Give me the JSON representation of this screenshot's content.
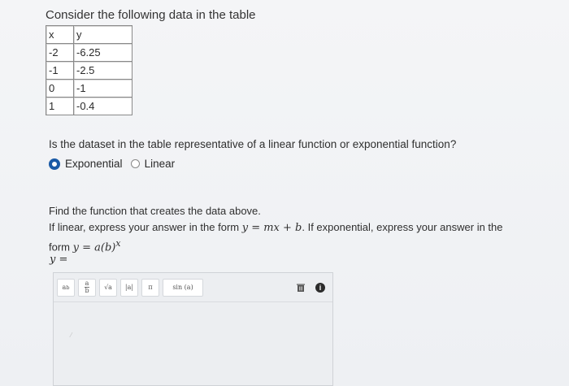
{
  "heading": "Consider the following data in the table",
  "table": {
    "headers": [
      "x",
      "y"
    ],
    "rows": [
      [
        "-2",
        "-6.25"
      ],
      [
        "-1",
        "-2.5"
      ],
      [
        "0",
        "-1"
      ],
      [
        "1",
        "-0.4"
      ]
    ]
  },
  "question": "Is the dataset in the table representative of a linear function or exponential function?",
  "options": [
    {
      "label": "Exponential",
      "selected": true
    },
    {
      "label": "Linear",
      "selected": false
    }
  ],
  "find_text": "Find the function that creates the data above.",
  "instruction": {
    "part1": "If linear, express your answer in the form ",
    "linear_form": "y = mx + b",
    "part2": ". If exponential, express your answer in the form ",
    "exp_form": "y = a(b)",
    "exp_sup": "x"
  },
  "answer_label": "y =",
  "toolbar": {
    "power": {
      "base": "a",
      "exp": "b"
    },
    "fraction": {
      "num": "a",
      "den": "b"
    },
    "sqrt": "√a",
    "abs": "|a|",
    "pi": "π",
    "sin": "sin (a)"
  },
  "colors": {
    "accent": "#1a5aa6",
    "toolbar_bg": "#eceef1"
  }
}
